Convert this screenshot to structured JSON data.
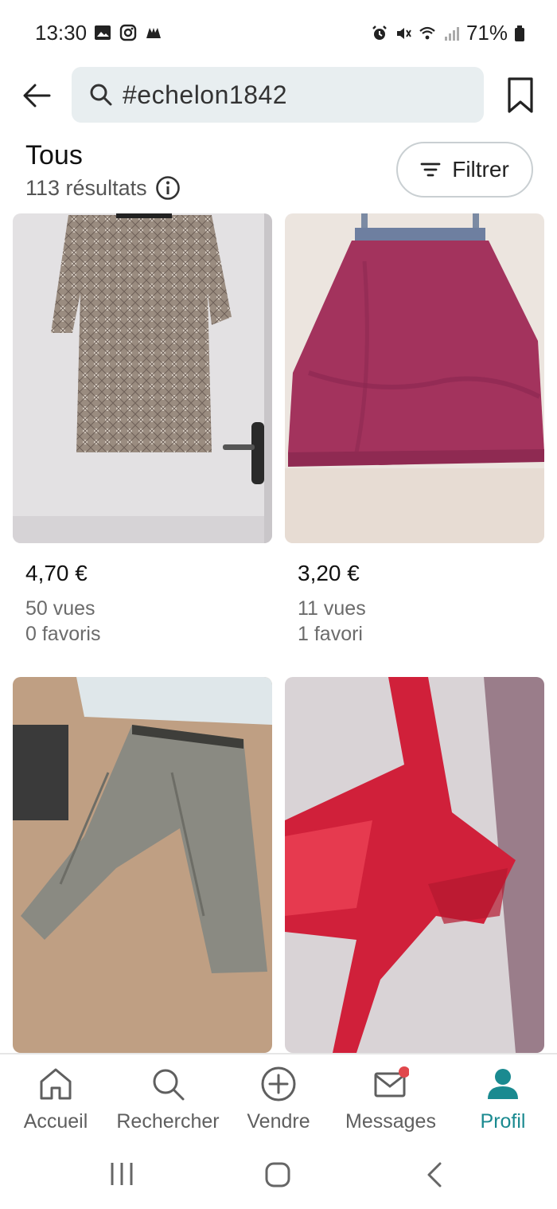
{
  "status_bar": {
    "time": "13:30",
    "battery": "71%",
    "left_icons": [
      "gallery-icon",
      "instagram-icon",
      "app-icon"
    ],
    "right_icons": [
      "alarm-icon",
      "mute-icon",
      "wifi-icon",
      "signal-icon",
      "battery-icon"
    ]
  },
  "search": {
    "query": "#echelon1842"
  },
  "header": {
    "title": "Tous",
    "results": "113 résultats",
    "filter_label": "Filtrer"
  },
  "items": [
    {
      "price": "4,70 €",
      "views": "50 vues",
      "favorites": "0 favoris",
      "image": "patterned-dress-photo"
    },
    {
      "price": "3,20 €",
      "views": "11 vues",
      "favorites": "1 favori",
      "image": "pink-sundress-photo"
    },
    {
      "image": "grey-trousers-photo"
    },
    {
      "image": "red-top-photo"
    }
  ],
  "bottom_nav": {
    "items": [
      {
        "label": "Accueil",
        "icon": "home-icon"
      },
      {
        "label": "Rechercher",
        "icon": "search-icon"
      },
      {
        "label": "Vendre",
        "icon": "plus-circle-icon"
      },
      {
        "label": "Messages",
        "icon": "mail-icon"
      },
      {
        "label": "Profil",
        "icon": "profile-icon",
        "active": true
      }
    ]
  },
  "colors": {
    "accent": "#1a8a90",
    "notification": "#e0474c",
    "search_bg": "#e8eef0"
  }
}
